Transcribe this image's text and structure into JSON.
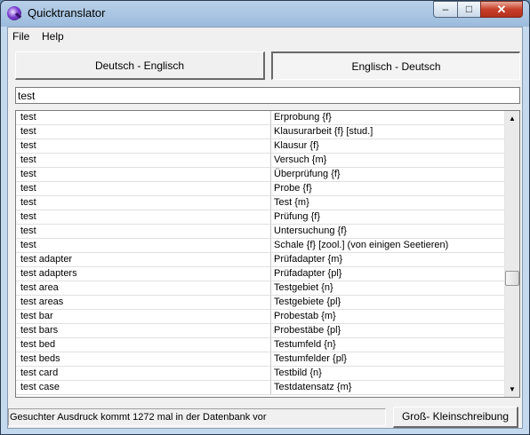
{
  "window": {
    "title": "Quicktranslator"
  },
  "caption_buttons": {
    "minimize": "–",
    "maximize": "□",
    "close": "✕"
  },
  "menu": [
    {
      "label": "File"
    },
    {
      "label": "Help"
    }
  ],
  "direction_buttons": {
    "de_en": "Deutsch - Englisch",
    "en_de": "Englisch - Deutsch",
    "active": "en_de"
  },
  "search": {
    "value": "test"
  },
  "results": [
    {
      "source": "test",
      "translation": "Erprobung {f}"
    },
    {
      "source": "test",
      "translation": "Klausurarbeit {f} [stud.]"
    },
    {
      "source": "test",
      "translation": "Klausur {f}"
    },
    {
      "source": "test",
      "translation": "Versuch {m}"
    },
    {
      "source": "test",
      "translation": "Überprüfung {f}"
    },
    {
      "source": "test",
      "translation": "Probe {f}"
    },
    {
      "source": "test",
      "translation": "Test {m}"
    },
    {
      "source": "test",
      "translation": "Prüfung {f}"
    },
    {
      "source": "test",
      "translation": "Untersuchung {f}"
    },
    {
      "source": "test",
      "translation": "Schale {f} [zool.] (von einigen Seetieren)"
    },
    {
      "source": "test adapter",
      "translation": "Prüfadapter {m}"
    },
    {
      "source": "test adapters",
      "translation": "Prüfadapter {pl}"
    },
    {
      "source": "test area",
      "translation": "Testgebiet {n}"
    },
    {
      "source": "test areas",
      "translation": "Testgebiete {pl}"
    },
    {
      "source": "test bar",
      "translation": "Probestab {m}"
    },
    {
      "source": "test bars",
      "translation": "Probestäbe {pl}"
    },
    {
      "source": "test bed",
      "translation": "Testumfeld {n}"
    },
    {
      "source": "test beds",
      "translation": "Testumfelder {pl}"
    },
    {
      "source": "test card",
      "translation": "Testbild {n}"
    },
    {
      "source": "test case",
      "translation": "Testdatensatz {m}"
    }
  ],
  "scrollbar": {
    "up_icon": "up-arrow",
    "down_icon": "down-arrow",
    "position_fraction": 0.6,
    "visible_fraction": 0.03
  },
  "status": {
    "message": "Gesuchter Ausdruck kommt 1272 mal in der Datenbank vor",
    "case_button": "Groß- Kleinschreibung"
  }
}
